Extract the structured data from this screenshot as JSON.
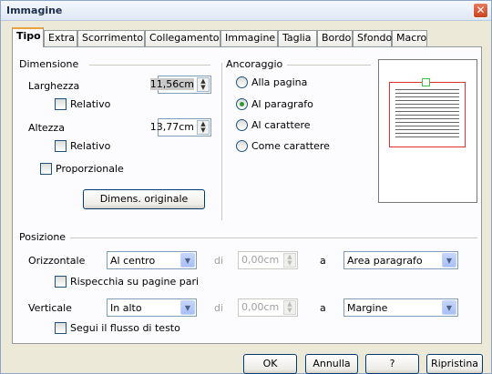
{
  "window": {
    "title": "Immagine",
    "close_glyph": "✕"
  },
  "tabs": [
    {
      "label": "Tipo",
      "active": true
    },
    {
      "label": "Extra"
    },
    {
      "label": "Scorrimento"
    },
    {
      "label": "Collegamento"
    },
    {
      "label": "Immagine"
    },
    {
      "label": "Taglia"
    },
    {
      "label": "Bordo"
    },
    {
      "label": "Sfondo"
    },
    {
      "label": "Macro"
    }
  ],
  "dimensione": {
    "heading": "Dimensione",
    "larghezza_label": "Larghezza",
    "larghezza_value": "11,56cm",
    "relativo1": "Relativo",
    "altezza_label": "Altezza",
    "altezza_value": "13,77cm",
    "relativo2": "Relativo",
    "proporzionale": "Proporzionale",
    "original_button": "Dimens. originale"
  },
  "ancoraggio": {
    "heading": "Ancoraggio",
    "options": [
      "Alla pagina",
      "Al paragrafo",
      "Al carattere",
      "Come carattere"
    ],
    "selected": "Al paragrafo"
  },
  "posizione": {
    "heading": "Posizione",
    "orizzontale_label": "Orizzontale",
    "orizzontale_value": "Al centro",
    "di1": "di",
    "spin1": "0,00cm",
    "a1": "a",
    "target1": "Area paragrafo",
    "rispecchia": "Rispecchia su pagine pari",
    "verticale_label": "Verticale",
    "verticale_value": "In alto",
    "di2": "di",
    "spin2": "0,00cm",
    "a2": "a",
    "target2": "Margine",
    "segui": "Segui il flusso di testo"
  },
  "buttons": {
    "ok": "OK",
    "annulla": "Annulla",
    "help": "?",
    "ripristina": "Ripristina"
  },
  "colors": {
    "accent": "#e8a33a",
    "preview_frame": "#e03030",
    "preview_anchor": "#40c040"
  }
}
